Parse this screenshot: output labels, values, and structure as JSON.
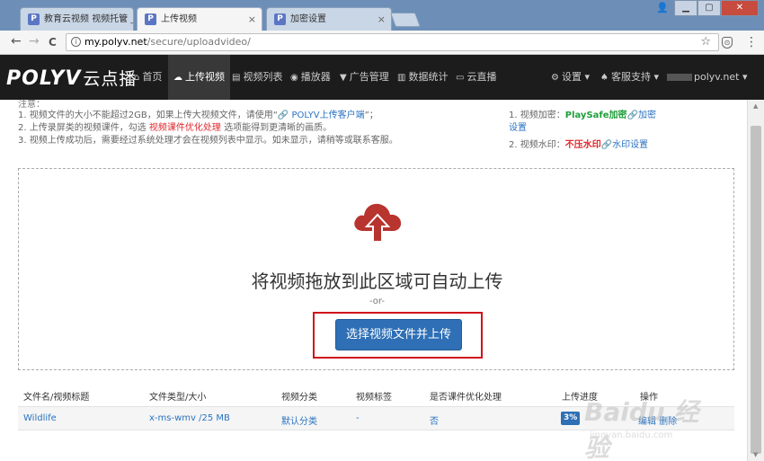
{
  "tabs": [
    {
      "title": "教育云视频 视频托管 _ 优",
      "active": false
    },
    {
      "title": "上传视频",
      "active": true
    },
    {
      "title": "加密设置",
      "active": false
    }
  ],
  "tab_close": "×",
  "favicon_letter": "P",
  "window": {
    "user": "👤",
    "minimize": "▁",
    "maximize": "▢",
    "close": "✕"
  },
  "address": {
    "host": "my.polyv.net",
    "path": "/secure/uploadvideo/",
    "info": "i",
    "star": "☆"
  },
  "nav_buttons": {
    "back": "←",
    "forward": "→",
    "reload": "C"
  },
  "menu_icon": "⋮",
  "ext_icon": "⊙",
  "site": {
    "logo": "POLYV",
    "logo_cn": "云点播",
    "nav": [
      {
        "icon": "⌂",
        "label": "首页",
        "active": false
      },
      {
        "icon": "☁",
        "label": "上传视频",
        "active": true
      },
      {
        "icon": "▤",
        "label": "视频列表",
        "active": false
      },
      {
        "icon": "◉",
        "label": "播放器",
        "active": false
      },
      {
        "icon": "▼",
        "label": "广告管理",
        "active": false
      },
      {
        "icon": "▥",
        "label": "数据统计",
        "active": false
      },
      {
        "icon": "▭",
        "label": "云直播",
        "active": false
      }
    ],
    "settings": {
      "icon": "⚙",
      "label": "设置 ▾"
    },
    "support": {
      "icon": "♠",
      "label": "客服支持 ▾"
    },
    "account": "polyv.net ▾"
  },
  "notes": {
    "title": "注意：",
    "line1_a": "1. 视频文件的大小不能超过2GB，如果上传大视频文件，请使用“",
    "line1_link": "🔗 POLYV上传客户端",
    "line1_b": "”；",
    "line2_a": "2. 上传录屏类的视频课件，勾选 ",
    "line2_red": "视频课件优化处理",
    "line2_b": " 选项能得到更清晰的画质。",
    "line3": "3. 视频上传成功后，需要经过系统处理才会在视频列表中显示。如未显示，请稍等或联系客服。"
  },
  "right_notes": {
    "enc_label": "1. 视频加密：",
    "enc_value": "PlaySafe加密",
    "enc_link": "🔗加密",
    "enc_link2": "设置",
    "wm_label": "2. 视频水印：",
    "wm_value": "不压水印",
    "wm_link": "🔗水印设置"
  },
  "dropzone": {
    "title": "将视频拖放到此区域可自动上传",
    "or": "-or-",
    "button": "选择视频文件并上传"
  },
  "table": {
    "headers": [
      "文件名/视频标题",
      "文件类型/大小",
      "视频分类",
      "视频标签",
      "是否课件优化处理",
      "上传进度",
      "操作"
    ],
    "rows": [
      {
        "name": "Wildlife",
        "type": "x-ms-wmv /25 MB",
        "category": "默认分类",
        "tag": "-",
        "optimize": "否",
        "progress": "3%",
        "progress_value": 3,
        "actions": "编辑 删除"
      }
    ]
  },
  "watermark": {
    "big": "Baidu 经验",
    "small": "jingyan.baidu.com"
  },
  "colors": {
    "accent": "#2e6fb5",
    "highlight": "#d0121b",
    "nav_bg": "#1c1c1c",
    "cloud": "#b8342f"
  }
}
